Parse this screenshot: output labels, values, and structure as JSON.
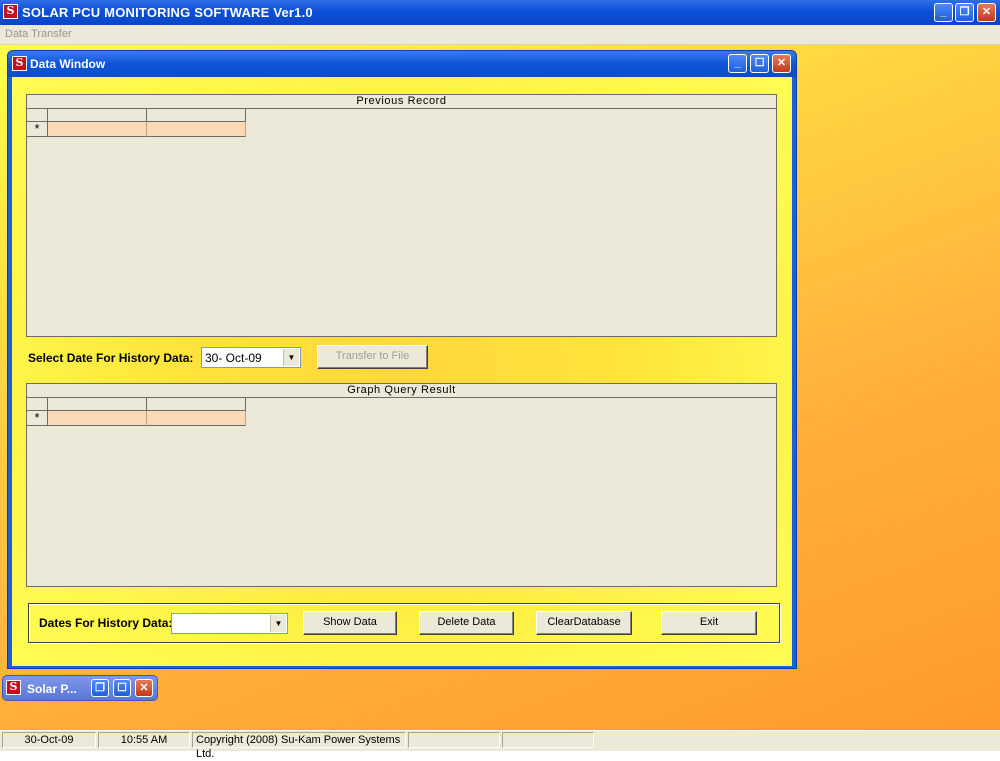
{
  "app": {
    "title": "SOLAR PCU MONITORING SOFTWARE Ver1.0",
    "logo_letter": "S",
    "controls": {
      "minimize": "_",
      "restore": "❐",
      "close": "✕"
    }
  },
  "menu": {
    "items": [
      {
        "label": "Data Transfer"
      }
    ]
  },
  "data_window": {
    "title": "Data Window",
    "previous_record": {
      "caption": "Previous  Record",
      "new_row_marker": "*"
    },
    "select_date_label": "Select Date For History Data:",
    "selected_date": "30- Oct-09",
    "transfer_button_label": "Transfer to File",
    "graph_query": {
      "caption": "Graph Query Result",
      "new_row_marker": "*"
    },
    "dates_label": "Dates For History Data:",
    "dates_value": "",
    "buttons": {
      "show_data": "Show Data",
      "delete_data": "Delete Data",
      "clear_database": "ClearDatabase",
      "exit": "Exit"
    }
  },
  "minimized_window": {
    "title": "Solar P..."
  },
  "status": {
    "date": "30-Oct-09",
    "time": "10:55 AM",
    "copyright": "Copyright (2008) Su-Kam Power Systems Ltd."
  },
  "colors": {
    "titlebar_blue": "#0b4fd8",
    "client_yellow": "#ffe43a",
    "grid_cell": "#fcd9b6",
    "logo_red": "#c4101a"
  }
}
